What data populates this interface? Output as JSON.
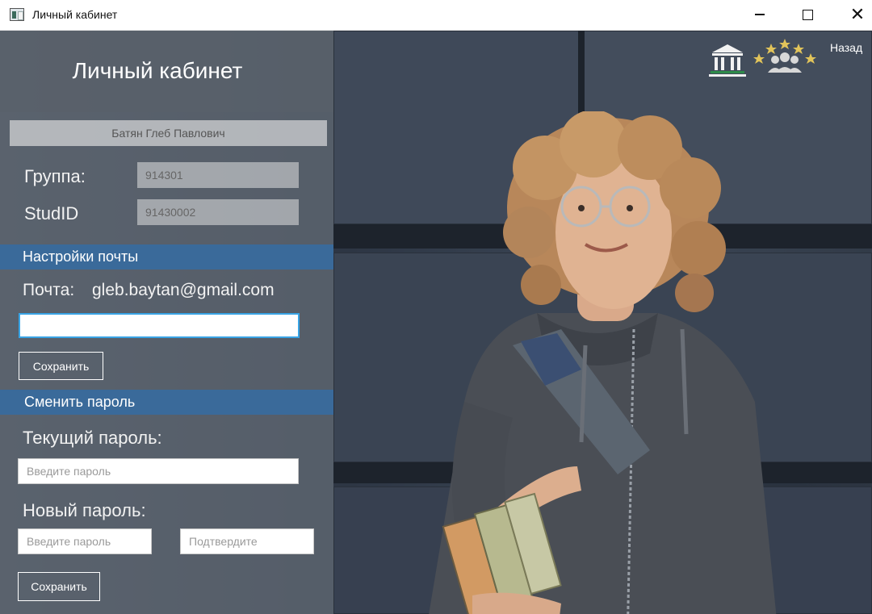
{
  "window": {
    "title": "Личный кабинет",
    "icon": "app-window-icon"
  },
  "header": {
    "back_label": "Назад",
    "icons": [
      "university-building-icon",
      "stars-group-icon"
    ]
  },
  "profile": {
    "page_title": "Личный кабинет",
    "full_name": "Батян Глеб Павлович",
    "group_label": "Группа:",
    "group_value": "914301",
    "studid_label": "StudID",
    "studid_value": "91430002"
  },
  "mail_settings": {
    "section_title": "Настройки почты",
    "mail_label": "Почта:",
    "current_email": "gleb.baytan@gmail.com",
    "new_email_value": "",
    "save_label": "Сохранить"
  },
  "password_settings": {
    "section_title": "Сменить пароль",
    "current_label": "Текущий пароль:",
    "current_placeholder": "Введите пароль",
    "new_label": "Новый пароль:",
    "new_placeholder": "Введите пароль",
    "confirm_placeholder": "Подтвердите",
    "save_label": "Сохранить"
  },
  "colors": {
    "section_bar": "#3a6a9a",
    "input_focus": "#39a4e5",
    "panel_overlay": "#6e7680"
  }
}
